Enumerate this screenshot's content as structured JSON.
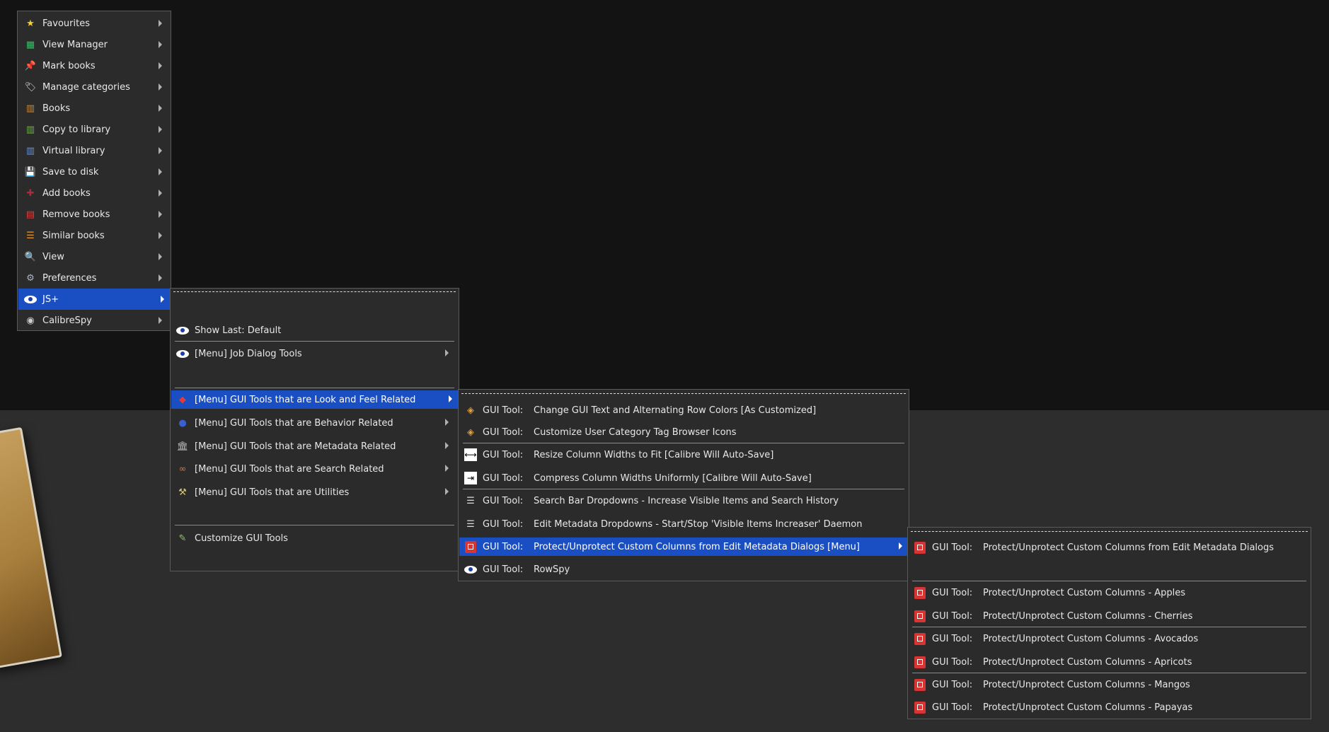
{
  "menu_main": {
    "items": [
      {
        "label": "Favourites",
        "icon": "star-icon",
        "glyph": "★",
        "color": "#f2d233"
      },
      {
        "label": "View Manager",
        "icon": "view-manager-icon",
        "glyph": "▦",
        "color": "#3fb86a"
      },
      {
        "label": "Mark books",
        "icon": "pin-icon",
        "glyph": "📌",
        "color": "#e23b2e"
      },
      {
        "label": "Manage categories",
        "icon": "tag-icon",
        "glyph": "🏷",
        "color": "#dddddd"
      },
      {
        "label": "Books",
        "icon": "books-icon",
        "glyph": "▥",
        "color": "#c98a3a"
      },
      {
        "label": "Copy to library",
        "icon": "copy-library-icon",
        "glyph": "▥",
        "color": "#6fb04a"
      },
      {
        "label": "Virtual library",
        "icon": "virtual-library-icon",
        "glyph": "▥",
        "color": "#6a8fd0"
      },
      {
        "label": "Save to disk",
        "icon": "save-icon",
        "glyph": "💾",
        "color": "#e0642f"
      },
      {
        "label": "Add books",
        "icon": "add-books-icon",
        "glyph": "✚",
        "color": "#b02a3b"
      },
      {
        "label": "Remove books",
        "icon": "remove-books-icon",
        "glyph": "▤",
        "color": "#d94040"
      },
      {
        "label": "Similar books",
        "icon": "similar-books-icon",
        "glyph": "☰",
        "color": "#e89a2e"
      },
      {
        "label": "View",
        "icon": "magnifier-icon",
        "glyph": "🔍",
        "color": "#cccccc"
      },
      {
        "label": "Preferences",
        "icon": "preferences-icon",
        "glyph": "⚙",
        "color": "#a8b4c4"
      },
      {
        "label": "JS+",
        "icon": "eye-icon",
        "glyph": "eye",
        "color": "#ffffff",
        "highlighted": true
      },
      {
        "label": "CalibreSpy",
        "icon": "calibrespy-eye-icon",
        "glyph": "◉",
        "color": "#cccccc"
      }
    ]
  },
  "menu_jsplus": {
    "show_last": "Show Last: Default",
    "job_dialog": "[Menu] Job Dialog Tools",
    "look_feel": "[Menu] GUI Tools that are Look and Feel Related",
    "behavior": "[Menu] GUI Tools that are Behavior Related",
    "metadata": "[Menu] GUI Tools that are Metadata Related",
    "search": "[Menu] GUI Tools that are Search Related",
    "utilities": "[Menu] GUI Tools that are Utilities",
    "customize": "Customize GUI Tools"
  },
  "menu_lookfeel": {
    "prefix": "GUI Tool:",
    "items": [
      "Change GUI Text and Alternating Row Colors [As Customized]",
      "Customize User Category Tag Browser Icons",
      "Resize Column Widths to Fit [Calibre Will Auto-Save]",
      "Compress Column Widths Uniformly [Calibre Will Auto-Save]",
      "Search Bar Dropdowns - Increase Visible Items and Search History",
      "Edit Metadata Dropdowns - Start/Stop 'Visible Items Increaser' Daemon",
      "Protect/Unprotect Custom Columns from Edit Metadata Dialogs [Menu]",
      "RowSpy"
    ]
  },
  "menu_protect": {
    "prefix": "GUI Tool:",
    "header": "Protect/Unprotect Custom Columns from Edit Metadata Dialogs",
    "items": [
      "Protect/Unprotect Custom Columns  - Apples",
      "Protect/Unprotect Custom Columns  - Cherries",
      "Protect/Unprotect Custom Columns  - Avocados",
      "Protect/Unprotect Custom Columns  - Apricots",
      "Protect/Unprotect Custom Columns  - Mangos",
      "Protect/Unprotect Custom Columns  - Papayas"
    ]
  },
  "colors": {
    "highlight": "#1a4ec3",
    "menu_bg": "#2b2b2b",
    "tool_red": "#d93434"
  }
}
